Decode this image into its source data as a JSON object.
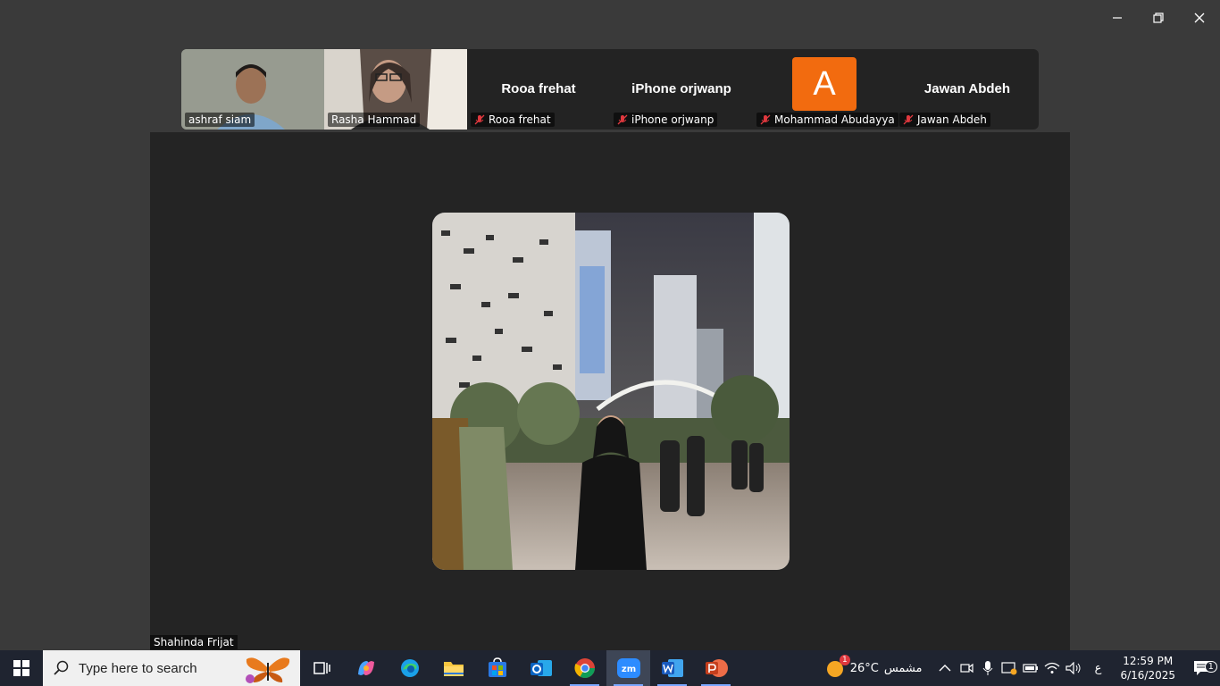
{
  "participants": [
    {
      "name": "ashraf siam",
      "type": "video"
    },
    {
      "name": "Rasha Hammad",
      "type": "video"
    },
    {
      "name": "Rooa frehat",
      "type": "name",
      "display": "Rooa frehat"
    },
    {
      "name": "iPhone orjwanp",
      "type": "name",
      "display": "iPhone orjwanp"
    },
    {
      "name": "Mohammad Abudayya",
      "type": "avatar",
      "initial": "A"
    },
    {
      "name": "Jawan Abdeh",
      "type": "name",
      "display": "Jawan Abdeh"
    }
  ],
  "active_speaker": {
    "name": "Shahinda Frijat"
  },
  "taskbar": {
    "search_placeholder": "Type here to search",
    "weather_temp": "26°C",
    "weather_text": "مشمس",
    "weather_badge": "1",
    "lang": "ع",
    "time": "12:59 PM",
    "date": "6/16/2025",
    "notification_count": "1"
  },
  "colors": {
    "avatar_orange": "#f26b0f",
    "taskbar_bg": "#1f2430",
    "mute_red": "#e0383e"
  }
}
